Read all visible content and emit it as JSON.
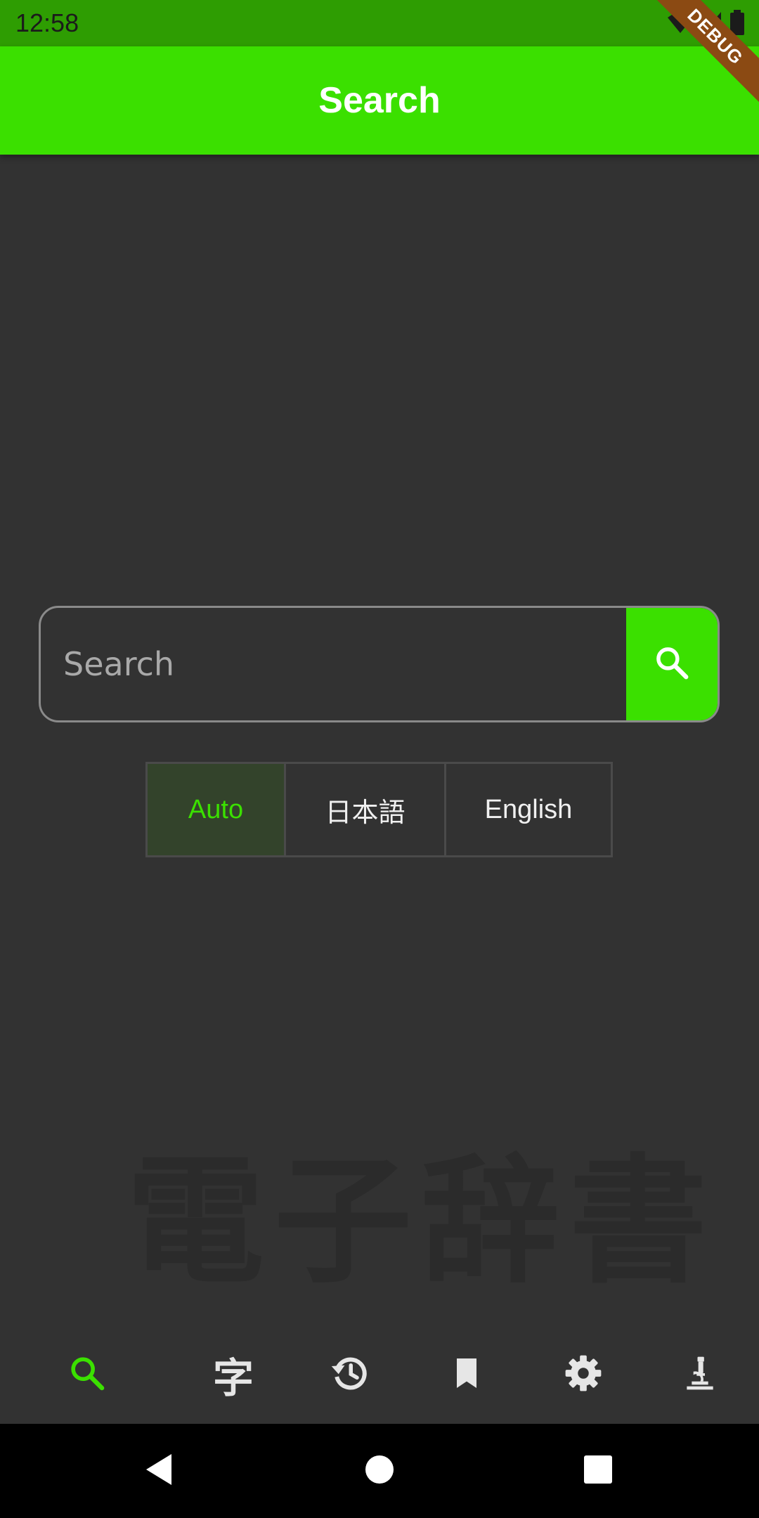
{
  "status_bar": {
    "time": "12:58"
  },
  "debug_banner": "DEBUG",
  "app_bar": {
    "title": "Search"
  },
  "search": {
    "placeholder": "Search",
    "value": ""
  },
  "language_toggle": {
    "options": [
      "Auto",
      "日本語",
      "English"
    ],
    "selected": "Auto"
  },
  "watermark": "電子辞書",
  "bottom_nav": {
    "items": [
      {
        "icon": "search-icon",
        "active": true
      },
      {
        "icon": "kanji-icon",
        "active": false
      },
      {
        "icon": "history-icon",
        "active": false
      },
      {
        "icon": "bookmark-icon",
        "active": false
      },
      {
        "icon": "settings-icon",
        "active": false
      },
      {
        "icon": "microscope-icon",
        "active": false
      }
    ],
    "kanji_glyph": "字"
  },
  "colors": {
    "accent": "#3be000",
    "status_bar": "#2e9d02",
    "background": "#323232",
    "selected_segment_bg": "#33432b"
  }
}
